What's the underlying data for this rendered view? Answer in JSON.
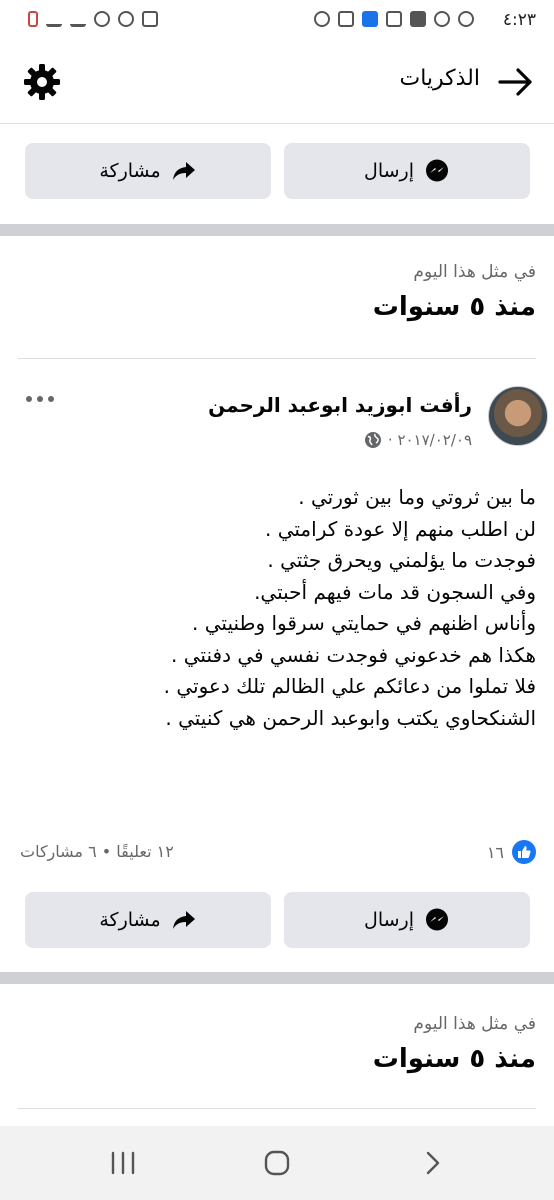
{
  "status_bar": {
    "time": "٤:٢٣",
    "icons": [
      "whatsapp-icon",
      "sync-icon",
      "mm-icon",
      "app-icon",
      "download-icon",
      "gallery-icon",
      "instagram-icon",
      "battery-icon",
      "signal-icon",
      "wifi-icon",
      "alarm-icon",
      "recycle-icon"
    ]
  },
  "header": {
    "title": "الذكريات"
  },
  "actions": {
    "send_label": "إرسال",
    "share_label": "مشاركة"
  },
  "memory": {
    "subtitle": "في مثل هذا اليوم",
    "title": "منذ ٥ سنوات"
  },
  "post": {
    "author": "رأفت ابوزيد ابوعبد الرحمن",
    "date": "٢٠١٧/٠٢/٠٩ ·",
    "lines": [
      "ما بين ثروتي وما بين ثورتي .",
      "لن اطلب منهم إلا عودة كرامتي .",
      "فوجدت ما يؤلمني ويحرق جثتي .",
      "وفي السجون قد مات فيهم أحبتي.",
      "وأناس اظنهم في حمايتي سرقوا وطنيتي .",
      "هكذا هم خدعوني فوجدت نفسي في دفنتي .",
      "فلا تملوا من دعائكم علي الظالم تلك دعوتي .",
      "الشنكحاوي يكتب وابوعبد الرحمن هي كنيتي ."
    ],
    "reaction_count": "١٦",
    "comments_shares": "١٢ تعليقًا • ٦ مشاركات"
  },
  "memory2": {
    "subtitle": "في مثل هذا اليوم",
    "title": "منذ ٥ سنوات"
  },
  "colors": {
    "accent": "#1877f2",
    "button_bg": "#e4e6eb",
    "separator": "#ced0d4",
    "secondary_text": "#65676b"
  }
}
